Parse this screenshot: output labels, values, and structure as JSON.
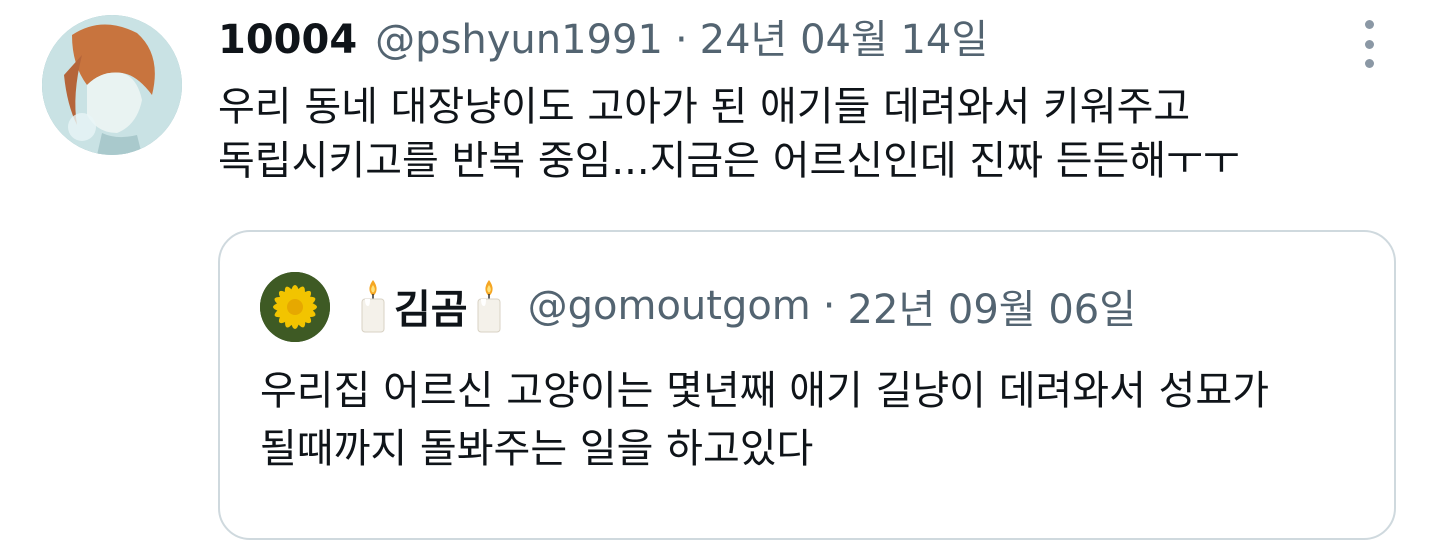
{
  "tweet": {
    "author": {
      "display_name": "10004",
      "handle": "@pshyun1991",
      "separator": "·",
      "date": "24년 04월 14일"
    },
    "text_lines": [
      "우리 동네 대장냥이도 고아가 된 애기들 데려와서 키워주고",
      "독립시키고를 반복 중임...지금은 어르신인데 진짜 든든해ㅜㅜ"
    ]
  },
  "quote": {
    "author": {
      "display_name": "김곰",
      "handle": "@gomoutgom",
      "separator": "·",
      "date": "22년 09월 06일"
    },
    "text_lines": [
      "우리집 어르신 고양이는 몇년째 애기 길냥이 데려와서 성묘가",
      "될때까지 돌봐주는 일을 하고있다"
    ]
  },
  "icons": {
    "more": "more-vertical-icon",
    "candle": "candle-emoji-icon"
  },
  "colors": {
    "text_primary": "#0f1419",
    "text_secondary": "#536471",
    "border": "#cfd9de"
  }
}
